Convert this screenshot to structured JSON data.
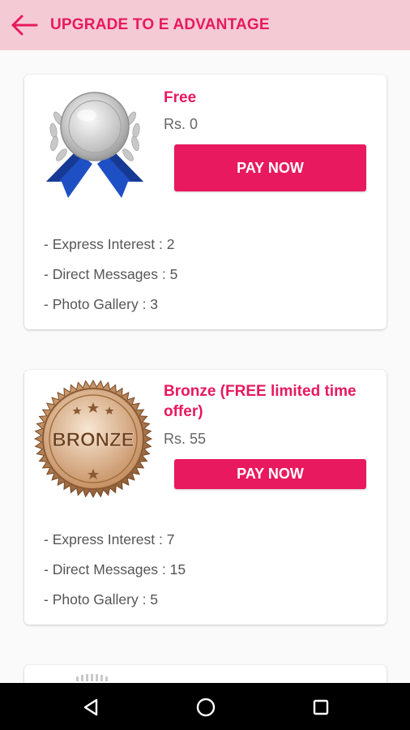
{
  "header": {
    "title": "UPGRADE TO E ADVANTAGE",
    "back_icon": "arrow-left-icon"
  },
  "colors": {
    "accent": "#e8195e",
    "header_bg": "#f4cbd5",
    "ribbon_blue": "#1f4fc4",
    "bronze": "#b9814a"
  },
  "plans": [
    {
      "name": "Free",
      "price": "Rs. 0",
      "button_label": "PAY NOW",
      "badge_icon": "silver-medal-icon",
      "features": [
        "- Express Interest : 2",
        "- Direct Messages : 5",
        "- Photo Gallery : 3"
      ]
    },
    {
      "name": "Bronze (FREE limited time offer)",
      "price": "Rs. 55",
      "button_label": "PAY NOW",
      "badge_icon": "bronze-seal-icon",
      "badge_text": "BRONZE",
      "features": [
        "- Express Interest : 7",
        "- Direct Messages : 15",
        "- Photo Gallery : 5"
      ]
    }
  ],
  "navbar": {
    "back_icon": "nav-back-icon",
    "home_icon": "nav-home-icon",
    "recents_icon": "nav-recents-icon"
  }
}
